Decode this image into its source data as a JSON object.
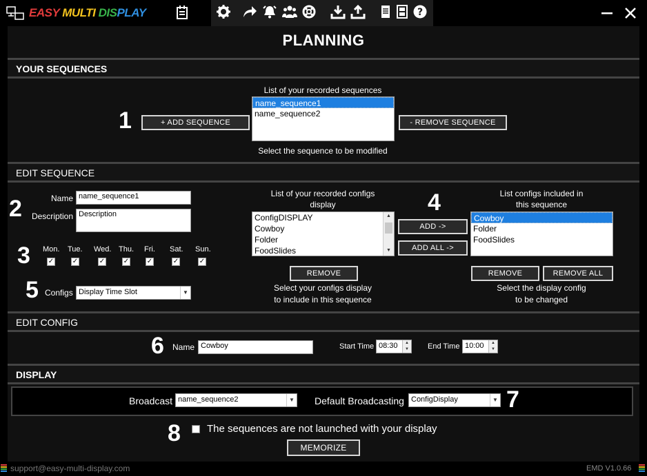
{
  "app": {
    "brand": [
      "EASY ",
      "MULTI ",
      "DIS",
      "PLAY"
    ],
    "title": "PLANNING"
  },
  "sections": {
    "your_sequences": "YOUR SEQUENCES",
    "edit_sequence": "EDIT SEQUENCE",
    "edit_config": "EDIT CONFIG",
    "display": "DISPLAY"
  },
  "sequences": {
    "list_label": "List of your recorded sequences",
    "items": [
      "name_sequence1",
      "name_sequence2"
    ],
    "selected_index": 0,
    "add_label": "+ ADD SEQUENCE",
    "remove_label": "- REMOVE SEQUENCE",
    "hint": "Select the sequence to be modified"
  },
  "edit_sequence": {
    "name_label": "Name",
    "name_value": "name_sequence1",
    "description_label": "Description",
    "description_value": "Description",
    "days": [
      "Mon.",
      "Tue.",
      "Wed.",
      "Thu.",
      "Fri.",
      "Sat.",
      "Sun."
    ],
    "days_checked": [
      true,
      true,
      true,
      true,
      true,
      true,
      true
    ],
    "configs_label": "Configs",
    "configs_value": "Display Time Slot",
    "recorded_label_1": "List of your recorded configs",
    "recorded_label_2": "display",
    "recorded_items": [
      "ConfigDISPLAY",
      "Cowboy",
      "Folder",
      "FoodSlides"
    ],
    "add_label": "ADD ->",
    "add_all_label": "ADD ALL ->",
    "included_label_1": "List configs included in",
    "included_label_2": "this sequence",
    "included_items": [
      "Cowboy",
      "Folder",
      "FoodSlides"
    ],
    "included_selected_index": 0,
    "remove_left_label": "REMOVE",
    "remove_right_label": "REMOVE",
    "remove_all_label": "REMOVE ALL",
    "hint_left_1": "Select your configs display",
    "hint_left_2": "to include in this sequence",
    "hint_right_1": "Select the display config",
    "hint_right_2": "to be changed"
  },
  "edit_config": {
    "name_label": "Name",
    "name_value": "Cowboy",
    "start_label": "Start Time",
    "start_value": "08:30",
    "end_label": "End Time",
    "end_value": "10:00"
  },
  "display": {
    "broadcast_label": "Broadcast",
    "broadcast_value": "name_sequence2",
    "default_label": "Default Broadcasting",
    "default_value": "ConfigDisplay",
    "checkbox_label": "The sequences are not launched with your display",
    "memorize_label": "MEMORIZE"
  },
  "annotations": [
    "1",
    "2",
    "3",
    "4",
    "5",
    "6",
    "7",
    "8"
  ],
  "footer": {
    "email": "support@easy-multi-display.com",
    "version": "EMD V1.0.66"
  },
  "colors": {
    "selection": "#1e7fe0",
    "brand_red": "#e23b3b",
    "brand_yellow": "#f3c21e",
    "brand_green": "#38b24a",
    "brand_blue": "#2f8fe0"
  }
}
